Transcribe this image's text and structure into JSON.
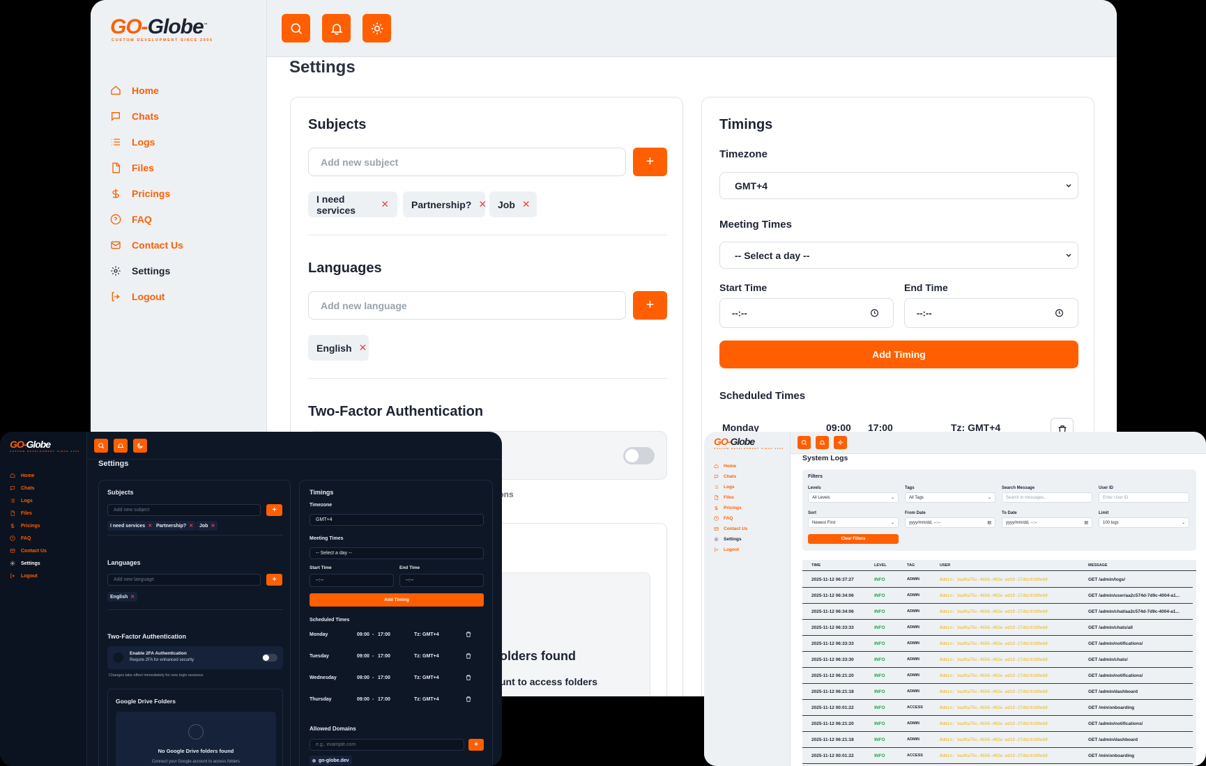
{
  "brand": {
    "name_go": "GO-",
    "name_globe": "Globe",
    "tm": "™",
    "tagline": "CUSTOM DEVELOPMENT SINCE 2005"
  },
  "topbar": {
    "icons": [
      "search-icon",
      "bell-icon",
      "sun-icon"
    ]
  },
  "sidebar": {
    "items": [
      {
        "label": "Home",
        "icon": "home-icon"
      },
      {
        "label": "Chats",
        "icon": "chat-icon"
      },
      {
        "label": "Logs",
        "icon": "list-icon"
      },
      {
        "label": "Files",
        "icon": "file-icon"
      },
      {
        "label": "Pricings",
        "icon": "dollar-icon"
      },
      {
        "label": "FAQ",
        "icon": "help-icon"
      },
      {
        "label": "Contact Us",
        "icon": "mail-icon"
      },
      {
        "label": "Settings",
        "icon": "gear-icon"
      },
      {
        "label": "Logout",
        "icon": "logout-icon"
      }
    ]
  },
  "settings": {
    "title": "Settings",
    "subjects": {
      "title": "Subjects",
      "placeholder": "Add new subject",
      "add": "+",
      "chips": [
        "I need services",
        "Partnership?",
        "Job"
      ],
      "remove": "✕"
    },
    "languages": {
      "title": "Languages",
      "placeholder": "Add new language",
      "add": "+",
      "chips": [
        "English"
      ]
    },
    "twofa": {
      "title": "Two-Factor Authentication",
      "partial_label": "y",
      "partial_note": "essions",
      "enable_label": "Enable 2FA Authentication",
      "enable_sub": "Require 2FA for enhanced security",
      "note": "Changes take effect immediately for new login sessions",
      "enabled": false
    },
    "drive": {
      "title": "Google Drive Folders",
      "empty_title": "No Google Drive folders found",
      "empty_sub": "Connect your Google account to access folders",
      "partial_title": "olders found",
      "partial_sub": "unt to access folders"
    },
    "timings": {
      "title": "Timings",
      "timezone_label": "Timezone",
      "timezone_value": "GMT+4",
      "meeting_label": "Meeting Times",
      "meeting_value": "-- Select a day --",
      "start_label": "Start Time",
      "end_label": "End Time",
      "time_placeholder": "--:--",
      "add_button": "Add Timing",
      "scheduled_label": "Scheduled Times",
      "partial_row": {
        "day": "Monday",
        "start": "09:00",
        "end": "17:00",
        "tz": "Tz: GMT+4"
      },
      "rows": [
        {
          "day": "Monday",
          "start": "09:00",
          "sep": "-",
          "end": "17:00",
          "tz": "Tz: GMT+4"
        },
        {
          "day": "Tuesday",
          "start": "09:00",
          "sep": "-",
          "end": "17:00",
          "tz": "Tz: GMT+4"
        },
        {
          "day": "Wednesday",
          "start": "09:00",
          "sep": "-",
          "end": "17:00",
          "tz": "Tz: GMT+4"
        },
        {
          "day": "Thursday",
          "start": "09:00",
          "sep": "-",
          "end": "17:00",
          "tz": "Tz: GMT+4"
        }
      ]
    },
    "domains": {
      "title": "Allowed Domains",
      "placeholder": "e.g., example.com",
      "add": "+",
      "items": [
        "go-globe.dev"
      ]
    }
  },
  "logs": {
    "title": "System Logs",
    "filters": {
      "title": "Filters",
      "level_label": "Levels",
      "level_value": "All Levels",
      "tags_label": "Tags",
      "tags_value": "All Tags",
      "search_label": "Search Message",
      "search_placeholder": "Search in messages...",
      "user_label": "User ID",
      "user_placeholder": "Enter User ID",
      "sort_label": "Sort",
      "sort_value": "Newest First",
      "from_label": "From Date",
      "from_value": "yyyy/mm/dd, --:--",
      "to_label": "To Date",
      "to_value": "yyyy/mm/dd, --:--",
      "limit_label": "Limit",
      "limit_value": "100 logs",
      "clear": "Clear Filters"
    },
    "columns": [
      "TIME",
      "LEVEL",
      "TAG",
      "USER",
      "MESSAGE"
    ],
    "rows": [
      {
        "time": "2025-11-12 06:37:27",
        "level": "INFO",
        "tag": "ADMIN",
        "user": "Admin: bad0a75c-4b56-482e-ad19-27dbc0190eb8",
        "msg": "GET /admin/logs/"
      },
      {
        "time": "2025-11-12 06:34:06",
        "level": "INFO",
        "tag": "ADMIN",
        "user": "Admin: bad0a75c-4b56-482e-ad19-27dbc0190eb8",
        "msg": "GET /admin/user/aa2c574d-7d9c-4004-a1..."
      },
      {
        "time": "2025-11-12 06:34:06",
        "level": "INFO",
        "tag": "ADMIN",
        "user": "Admin: bad0a75c-4b56-482e-ad19-27dbc0190eb8",
        "msg": "GET /admin/chat/aa2c574d-7d9c-4004-a1..."
      },
      {
        "time": "2025-11-12 06:33:33",
        "level": "INFO",
        "tag": "ADMIN",
        "user": "Admin: bad0a75c-4b56-482e-ad19-27dbc0190eb8",
        "msg": "GET /admin/chats/all"
      },
      {
        "time": "2025-11-12 06:33:33",
        "level": "INFO",
        "tag": "ADMIN",
        "user": "Admin: bad0a75c-4b56-482e-ad19-27dbc0190eb8",
        "msg": "GET /admin/notifications/"
      },
      {
        "time": "2025-11-12 06:33:30",
        "level": "INFO",
        "tag": "ADMIN",
        "user": "Admin: bad0a75c-4b56-482e-ad19-27dbc0190eb8",
        "msg": "GET /admin/chats/"
      },
      {
        "time": "2025-11-12 06:21:20",
        "level": "INFO",
        "tag": "ADMIN",
        "user": "Admin: bad0a75c-4b56-482e-ad19-27dbc0190eb8",
        "msg": "GET /admin/notifications/"
      },
      {
        "time": "2025-11-12 06:21:18",
        "level": "INFO",
        "tag": "ADMIN",
        "user": "Admin: bad0a75c-4b56-482e-ad19-27dbc0190eb8",
        "msg": "GET /admin/dashboard"
      },
      {
        "time": "2025-11-12 00:01:22",
        "level": "INFO",
        "tag": "ACCESS",
        "user": "Admin: bad0a75c-4b56-482e-ad19-27dbc0190eb8",
        "msg": "GET /min/onboarding"
      },
      {
        "time": "2025-11-12 06:21:20",
        "level": "INFO",
        "tag": "ADMIN",
        "user": "Admin: bad0a75c-4b56-482e-ad19-27dbc0190eb8",
        "msg": "GET /admin/notifications/"
      },
      {
        "time": "2025-11-12 06:21:18",
        "level": "INFO",
        "tag": "ADMIN",
        "user": "Admin: bad0a75c-4b56-482e-ad19-27dbc0190eb8",
        "msg": "GET /admin/dashboard"
      },
      {
        "time": "2025-11-12 00:01:22",
        "level": "INFO",
        "tag": "ACCESS",
        "user": "Admin: bad0a75c-4b56-482e-ad19-27dbc0190eb8",
        "msg": "GET /min/onboarding"
      }
    ]
  },
  "colors": {
    "accent": "#ff5f00",
    "navy": "#1c2333",
    "dark_bg": "#0e1726",
    "info_green": "#16a34a",
    "user_yellow": "#eab308"
  }
}
